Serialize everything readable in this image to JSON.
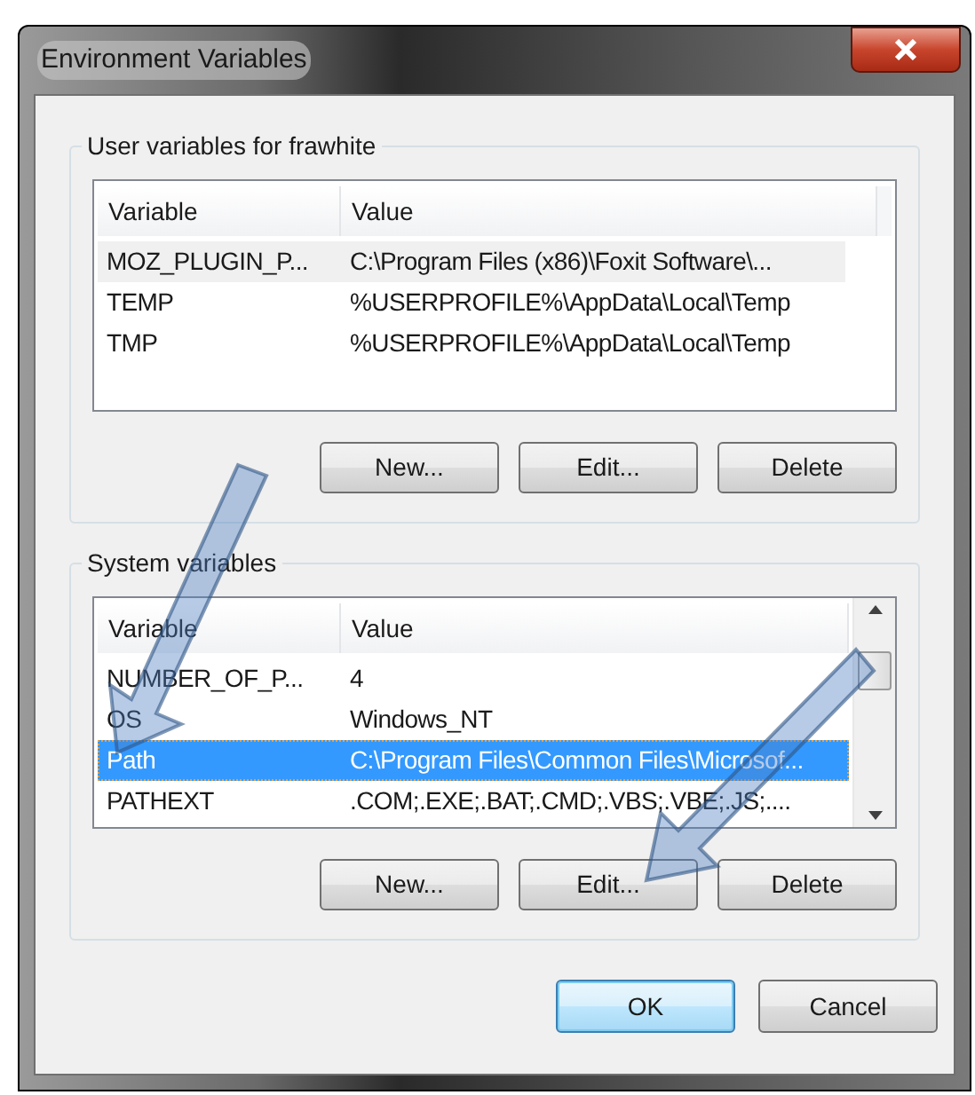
{
  "window": {
    "title": "Environment Variables"
  },
  "groups": [
    {
      "label": "User variables for frawhite",
      "focused": false,
      "columns": [
        "Variable",
        "Value"
      ],
      "scrollbar": false,
      "rows": [
        {
          "cells": [
            "MOZ_PLUGIN_P...",
            "C:\\Program Files (x86)\\Foxit Software\\..."
          ],
          "selected": true
        },
        {
          "cells": [
            "TEMP",
            "%USERPROFILE%\\AppData\\Local\\Temp"
          ],
          "selected": false
        },
        {
          "cells": [
            "TMP",
            "%USERPROFILE%\\AppData\\Local\\Temp"
          ],
          "selected": false
        }
      ],
      "buttons": [
        "New...",
        "Edit...",
        "Delete"
      ]
    },
    {
      "label": "System variables",
      "focused": true,
      "columns": [
        "Variable",
        "Value"
      ],
      "scrollbar": true,
      "rows": [
        {
          "cells": [
            "NUMBER_OF_P...",
            "4"
          ],
          "selected": false
        },
        {
          "cells": [
            "OS",
            "Windows_NT"
          ],
          "selected": false
        },
        {
          "cells": [
            "Path",
            "C:\\Program Files\\Common Files\\Microsof..."
          ],
          "selected": true
        },
        {
          "cells": [
            "PATHEXT",
            ".COM;.EXE;.BAT;.CMD;.VBS;.VBE;.JS;...."
          ],
          "selected": false
        }
      ],
      "buttons": [
        "New...",
        "Edit...",
        "Delete"
      ]
    }
  ],
  "dialog_buttons": [
    {
      "label": "OK",
      "default": true
    },
    {
      "label": "Cancel",
      "default": false
    }
  ]
}
